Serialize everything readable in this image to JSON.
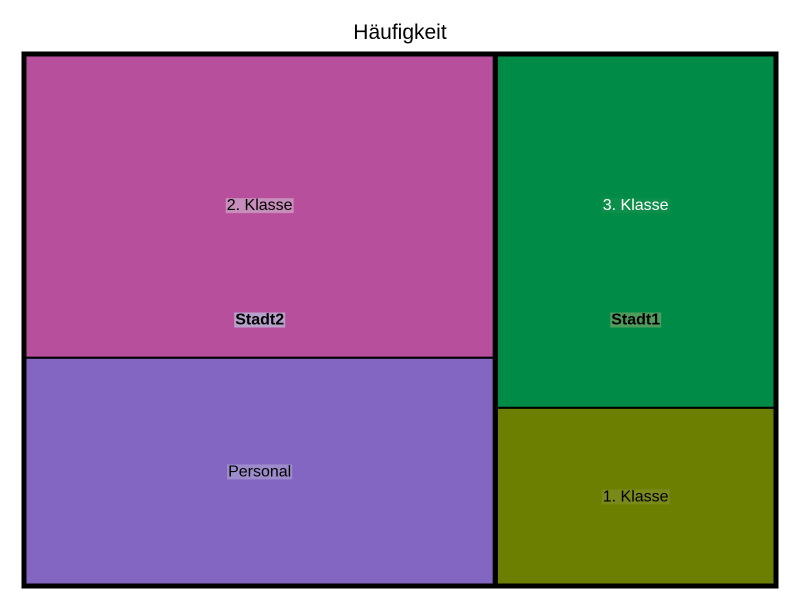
{
  "chart_data": {
    "type": "treemap",
    "title": "Häufigkeit",
    "groups": [
      {
        "name": "Stadt2",
        "label_color": "#000000",
        "label_bg": "#b7a0c9",
        "leaves": [
          {
            "name": "2. Klasse",
            "value": 209,
            "color": "#b84f9d",
            "label_color": "#000000",
            "label_bg": "#c78dbb"
          },
          {
            "name": "Personal",
            "value": 157,
            "color": "#8366c2",
            "label_color": "#000000",
            "label_bg": "#9d8ccb"
          }
        ]
      },
      {
        "name": "Stadt1",
        "label_color": "#000000",
        "label_bg": "#4f9b5c",
        "leaves": [
          {
            "name": "3. Klasse",
            "value": 145,
            "color": "#008c46",
            "label_color": "#ffffff",
            "label_bg": "#0d8f4b"
          },
          {
            "name": "1. Klasse",
            "value": 73,
            "color": "#6d7f00",
            "label_color": "#000000",
            "label_bg": "#7a8a1a"
          }
        ]
      }
    ]
  }
}
